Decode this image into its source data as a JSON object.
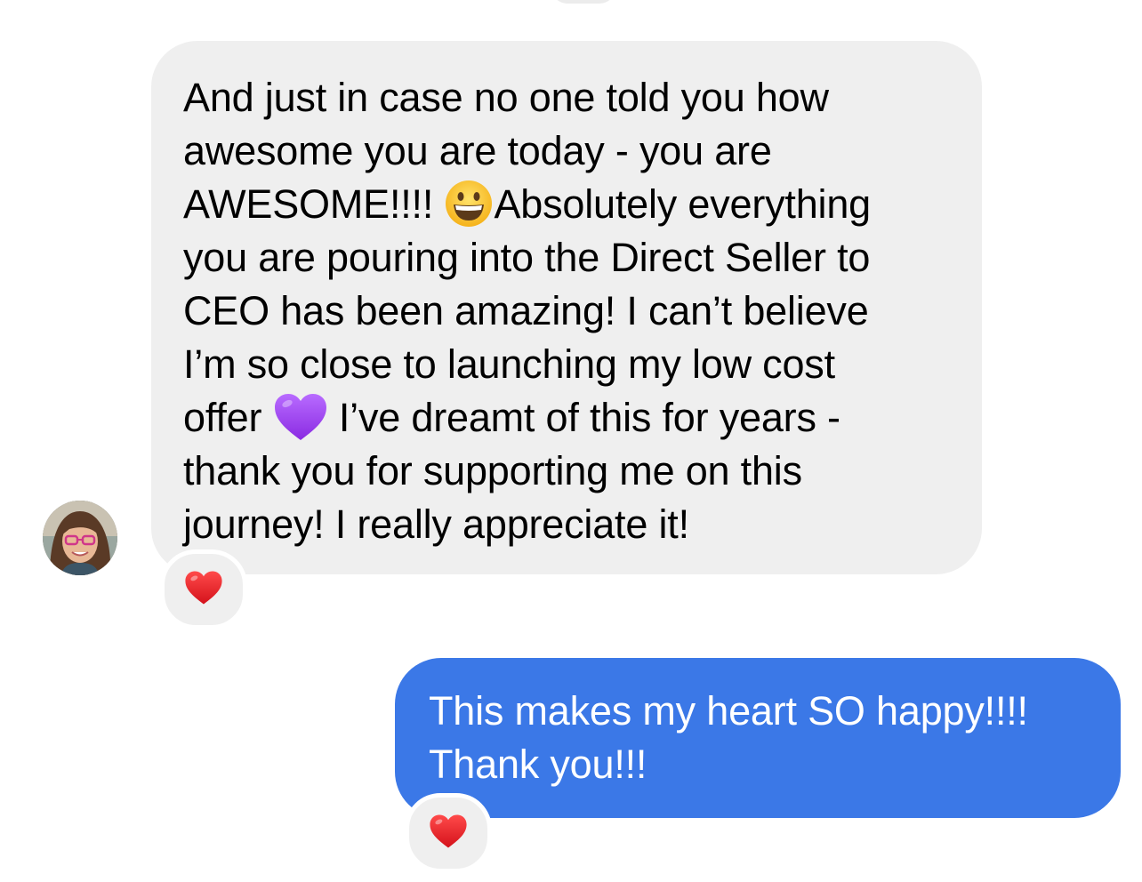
{
  "conversation": {
    "incoming": {
      "sender_avatar": "profile-photo",
      "lines": [
        "And just in case no one told you how",
        "awesome you are today - you are",
        "AWESOME!!!! ",
        "Absolutely everything",
        "you are pouring into the Direct Seller to",
        "CEO has been amazing! I can’t believe",
        "I’m so close to launching my low cost",
        "offer ",
        " I’ve dreamt of this for years -",
        "thank you for supporting me on this",
        "journey! I really appreciate it!"
      ],
      "inline_emojis": [
        "grinning-face-icon",
        "purple-heart-icon"
      ],
      "reaction": "red-heart-icon",
      "bubble_color": "#efefef"
    },
    "outgoing": {
      "lines": [
        "This makes my heart SO happy!!!!",
        "Thank you!!!"
      ],
      "reaction": "red-heart-icon",
      "bubble_color": "#3b78e7"
    }
  }
}
